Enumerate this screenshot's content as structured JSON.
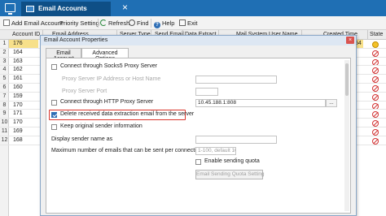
{
  "tabbar": {
    "active_tab": "Email Accounts",
    "close_glyph": "×"
  },
  "toolbar": {
    "add_email_account": "Add Email Account",
    "priority_setting": "Priority Setting",
    "refresh": "Refresh",
    "find": "Find",
    "help": "Help",
    "exit": "Exit"
  },
  "grid": {
    "columns": [
      "Account ID",
      "Email Address",
      "Server Type",
      "Send Email",
      "Data Extract",
      "Mail System User Name",
      "Created Time",
      "State"
    ],
    "rows": [
      {
        "num": "1",
        "id": "176",
        "extra": "54",
        "state": "ok"
      },
      {
        "num": "2",
        "id": "164",
        "state": "no"
      },
      {
        "num": "3",
        "id": "163",
        "state": "no"
      },
      {
        "num": "4",
        "id": "162",
        "state": "no"
      },
      {
        "num": "5",
        "id": "161",
        "state": "no"
      },
      {
        "num": "6",
        "id": "160",
        "state": "no"
      },
      {
        "num": "7",
        "id": "159",
        "state": "no"
      },
      {
        "num": "8",
        "id": "170",
        "state": "no"
      },
      {
        "num": "9",
        "id": "171",
        "state": "no"
      },
      {
        "num": "10",
        "id": "170",
        "state": "no"
      },
      {
        "num": "11",
        "id": "169",
        "state": "no"
      },
      {
        "num": "12",
        "id": "168",
        "state": "no"
      }
    ]
  },
  "dialog": {
    "title": "Email Account Properties",
    "close_glyph": "×",
    "tabs": [
      "Email Account",
      "Advanced Options"
    ],
    "socks5_label": "Connect through Socks5 Proxy Server",
    "socks5_addr_label": "Proxy Server IP Address or Host Name",
    "socks5_port_label": "Proxy Server Port",
    "http_label": "Connect through HTTP Proxy Server",
    "http_value": "10.45.188.1:808",
    "browse_label": "...",
    "delete_label": "Delete received data extraction email from the server",
    "keep_sender_label": "Keep original sender information",
    "display_sender_label": "Display sender name as",
    "max_emails_label": "Maximum number of emails that can be sent per connection",
    "max_emails_placeholder": "1-100, default 10",
    "enable_quota_label": "Enable sending quota",
    "quota_button": "Email Sending Quota Setting"
  }
}
